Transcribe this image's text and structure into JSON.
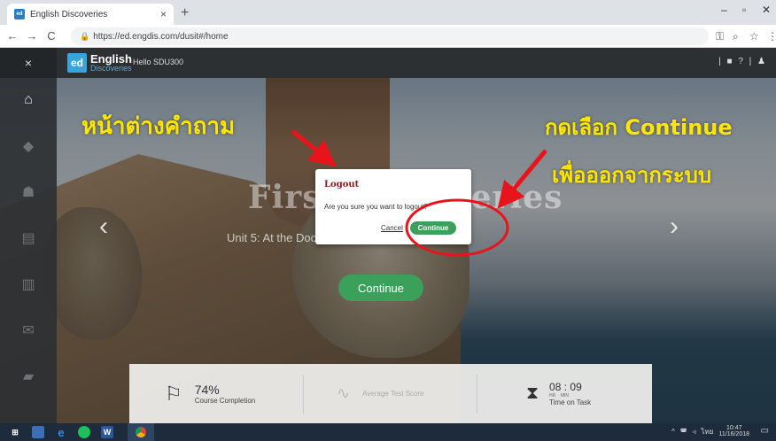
{
  "browser": {
    "tab_title": "English Discoveries",
    "tab_favicon": "ed",
    "new_tab": "+",
    "url": "https://ed.engdis.com/dusit#/home",
    "win_min": "–",
    "win_max": "▫",
    "win_close": "✕"
  },
  "app": {
    "close_label": "×",
    "logo_badge": "ed",
    "logo_title": "English",
    "logo_sub": "Discoveries",
    "greeting": "Hello SDU300",
    "top_icons": "| ■ ? | ♟"
  },
  "hero": {
    "title": "First Discoveries",
    "subtitle": "Unit 5: At the Doctor – Making an Appointment",
    "continue_label": "Continue"
  },
  "stats": {
    "course_completion_value": "74%",
    "course_completion_label": "Course Completion",
    "test_score_label": "Average Test Score",
    "time_value": "08 : 09",
    "time_units": "HR    MIN",
    "time_label": "Time on Task"
  },
  "modal": {
    "title": "Logout",
    "message": "Are you sure you want to logout?",
    "cancel_label": "Cancel",
    "continue_label": "Continue"
  },
  "annotations": {
    "left_text": "หน้าต่างคำถาม",
    "right_line1": "กดเลือก Continue",
    "right_line2": "เพื่อออกจากระบบ"
  },
  "taskbar": {
    "lang": "ไทย",
    "time": "10:47",
    "date": "11/16/2018"
  },
  "colors": {
    "accent_green": "#3aa05a",
    "annotation_yellow": "#ffe600",
    "annotation_red": "#e8141c",
    "logout_title": "#8b1a1a"
  }
}
